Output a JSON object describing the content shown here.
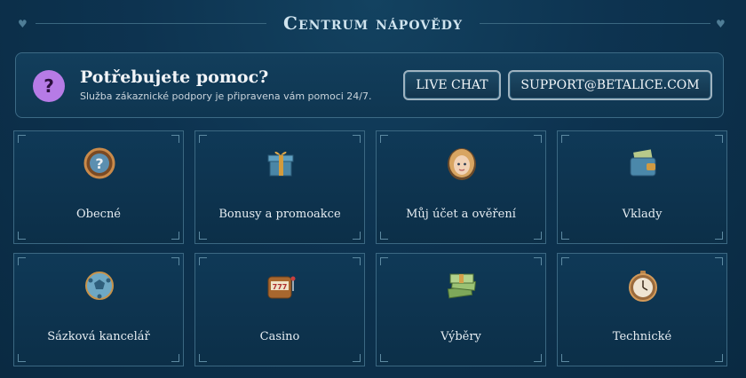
{
  "header": {
    "title": "Centrum nápovědy"
  },
  "help": {
    "title": "Potřebujete pomoc?",
    "subtitle": "Služba zákaznické podpory je připravena vám pomoci 24/7.",
    "badge": "?",
    "live_chat_label": "LIVE CHAT",
    "email_label": "SUPPORT@BETALICE.COM"
  },
  "categories": [
    {
      "label": "Obecné",
      "icon": "question-coin-icon"
    },
    {
      "label": "Bonusy a promoakce",
      "icon": "gift-box-icon"
    },
    {
      "label": "Můj účet a ověření",
      "icon": "alice-portrait-icon"
    },
    {
      "label": "Vklady",
      "icon": "money-wallet-icon"
    },
    {
      "label": "Sázková kancelář",
      "icon": "football-icon"
    },
    {
      "label": "Casino",
      "icon": "slot-machine-icon"
    },
    {
      "label": "Výběry",
      "icon": "cash-stack-icon"
    },
    {
      "label": "Technické",
      "icon": "pocket-watch-icon"
    }
  ],
  "colors": {
    "background": "#0d3350",
    "accent": "#b67be6",
    "border": "#3b6882"
  }
}
